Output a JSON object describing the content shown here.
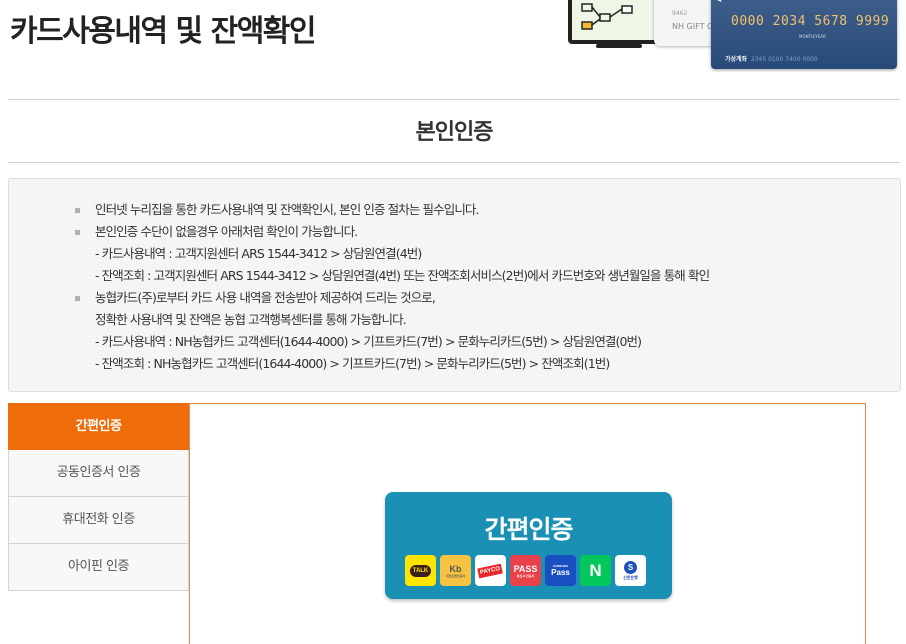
{
  "page": {
    "title": "카드사용내역 및 잔액확인"
  },
  "hero": {
    "gift_card_label": "NH GIFT CA",
    "gift_card_small": "9462",
    "card_number": "0000 2034 5678 9999",
    "valid_label": "MONTH/YEAR",
    "account_label": "가상계좌",
    "account_number": "2345 0100 7400 0000",
    "monitor_icon": "monitor-flowchart-icon"
  },
  "section": {
    "title": "본인인증"
  },
  "notice": {
    "items": [
      {
        "text": "인터넷 누리집을 통한 카드사용내역 및 잔액확인시, 본인 인증 절차는 필수입니다.",
        "subs": []
      },
      {
        "text": "본인인증 수단이 없을경우 아래처럼 확인이 가능합니다.",
        "subs": [
          "- 카드사용내역 : 고객지원센터 ARS 1544-3412 > 상담원연결(4번)",
          "- 잔액조회 : 고객지원센터 ARS 1544-3412 > 상담원연결(4번) 또는 잔액조회서비스(2번)에서 카드번호와 생년월일을 통해 확인"
        ]
      },
      {
        "text": "농협카드(주)로부터 카드 사용 내역을 전송받아 제공하여 드리는 것으로,",
        "subs": [
          "정확한 사용내역 및 잔액은 농협 고객행복센터를 통해 가능합니다.",
          "- 카드사용내역 : NH농협카드 고객센터(1644-4000) > 기프트카드(7번) > 문화누리카드(5번) > 상담원연결(0번)",
          "- 잔액조회 : NH농협카드 고객센터(1644-4000) > 기프트카드(7번) > 문화누리카드(5번) > 잔액조회(1번)"
        ]
      }
    ]
  },
  "tabs": [
    {
      "label": "간편인증",
      "active": true
    },
    {
      "label": "공동인증서 인증",
      "active": false
    },
    {
      "label": "휴대전화 인증",
      "active": false
    },
    {
      "label": "아이핀 인증",
      "active": false
    }
  ],
  "easy_auth": {
    "label": "간편인증",
    "providers": [
      {
        "icon": "kakaotalk-icon",
        "text": "TALK"
      },
      {
        "icon": "kb-bank-icon",
        "text": "Kb",
        "sub": "국민은행인증서"
      },
      {
        "icon": "payco-icon",
        "text": "PAYCO"
      },
      {
        "icon": "pass-icon",
        "text": "PASS",
        "sub": "통신사 인증서"
      },
      {
        "icon": "samsung-pass-icon",
        "text": "Pass",
        "sub": "SAMSUNG"
      },
      {
        "icon": "naver-icon",
        "text": "N"
      },
      {
        "icon": "shinhan-bank-icon",
        "text": "신한은행"
      }
    ]
  },
  "colors": {
    "accent_orange": "#ef6c0a",
    "button_teal": "#1a90b4",
    "notice_bg": "#f5f5f5"
  }
}
